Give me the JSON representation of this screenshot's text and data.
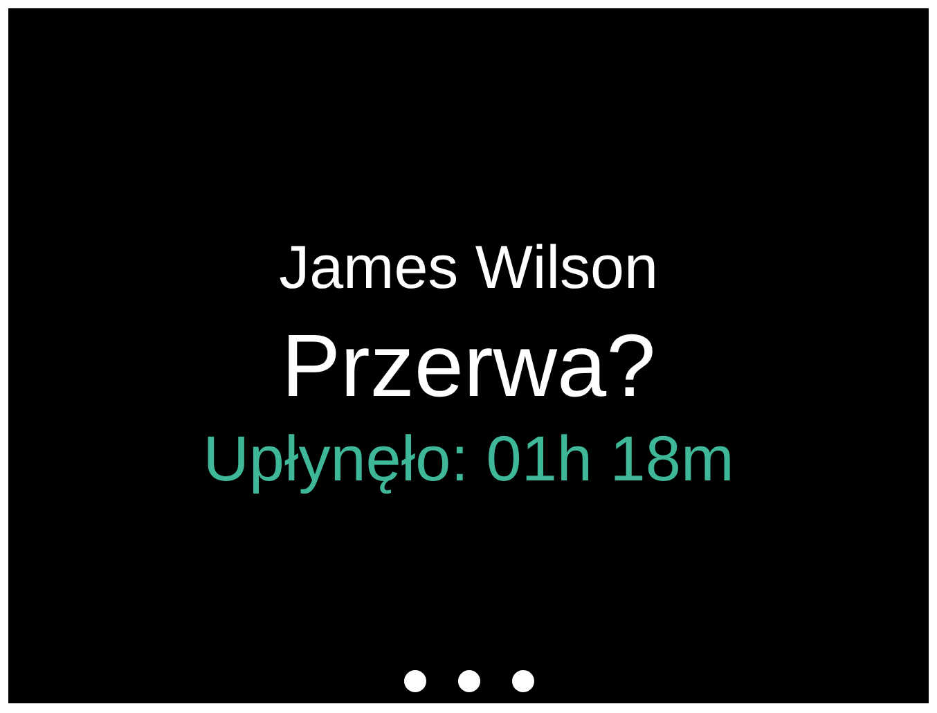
{
  "name": "James Wilson",
  "question": "Przerwa?",
  "elapsed": "Upłynęło: 01h 18m"
}
